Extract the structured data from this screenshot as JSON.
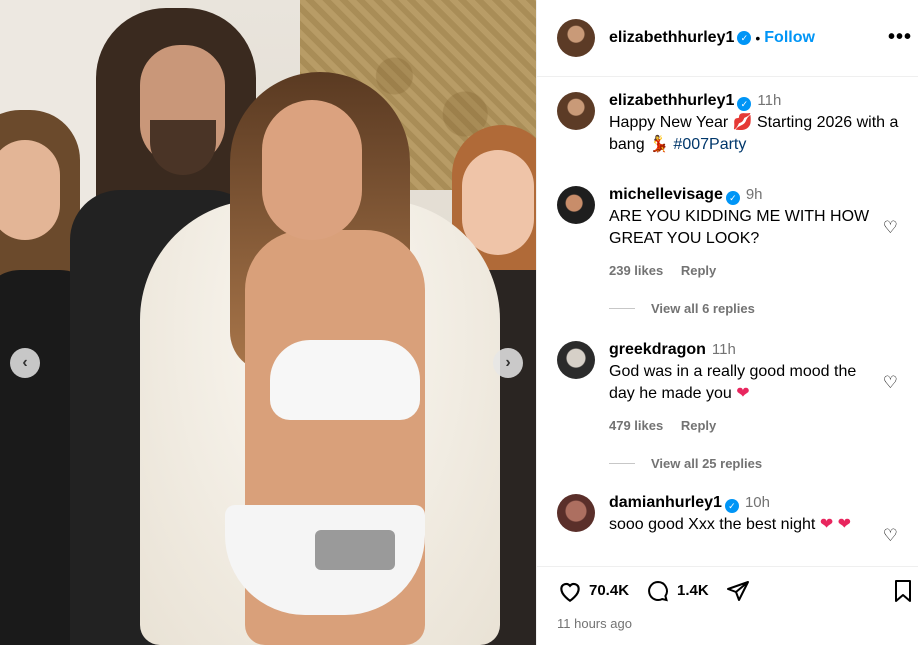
{
  "post": {
    "author": "elizabethhurley1",
    "follow_label": "Follow",
    "dot": "•",
    "more_label": "•••"
  },
  "caption": {
    "username": "elizabethhurley1",
    "time": "11h",
    "text": "Happy New Year 💋 Starting 2026 with a bang 💃",
    "hashtag": "#007Party"
  },
  "comments": [
    {
      "username": "michellevisage",
      "time": "9h",
      "text": "ARE YOU KIDDING ME WITH HOW GREAT YOU LOOK?",
      "likes": "239 likes",
      "reply": "Reply",
      "view_replies": "View all 6 replies"
    },
    {
      "username": "greekdragon",
      "time": "11h",
      "text": "God was in a really good mood the day he made you",
      "emoji": "❤",
      "likes": "479 likes",
      "reply": "Reply",
      "view_replies": "View all 25 replies"
    },
    {
      "username": "damianhurley1",
      "time": "10h",
      "text": "sooo good Xxx the best night",
      "emoji": "❤ ❤"
    }
  ],
  "actions": {
    "likes_count": "70.4K",
    "comments_count": "1.4K"
  },
  "timestamp": "11 hours ago",
  "carousel": {
    "prev": "‹",
    "next": "›"
  },
  "colors": {
    "accent": "#0095f6",
    "muted": "#737373",
    "heart": "#e8265e"
  }
}
